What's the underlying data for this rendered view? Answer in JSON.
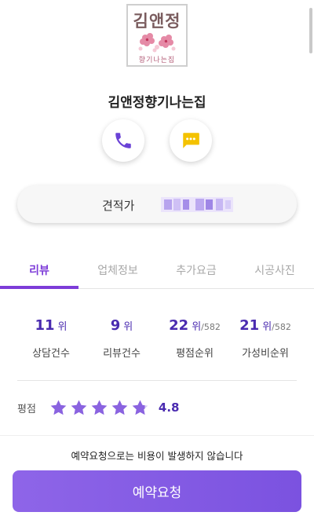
{
  "logo": {
    "title": "김앤정",
    "subtitle": "향기나는집"
  },
  "shop": {
    "name": "김앤정향기나는집"
  },
  "actions": {
    "phone_icon": "phone-icon",
    "chat_icon": "chat-bubble-icon",
    "accent": "#6a42d6",
    "chat_color": "#f4c200"
  },
  "estimate": {
    "label": "견적가"
  },
  "tabs": [
    {
      "label": "리뷰",
      "active": true
    },
    {
      "label": "업체정보",
      "active": false
    },
    {
      "label": "추가요금",
      "active": false
    },
    {
      "label": "시공사진",
      "active": false
    }
  ],
  "stats": [
    {
      "value": "11",
      "unit": "위",
      "total": "",
      "caption": "상담건수"
    },
    {
      "value": "9",
      "unit": "위",
      "total": "",
      "caption": "리뷰건수"
    },
    {
      "value": "22",
      "unit": "위",
      "total": "/582",
      "caption": "평점순위"
    },
    {
      "value": "21",
      "unit": "위",
      "total": "/582",
      "caption": "가성비순위"
    }
  ],
  "rating": {
    "label": "평점",
    "score": "4.8",
    "stars_value": 4.8,
    "stars_max": 5,
    "star_color": "#8a63e0"
  },
  "footer": {
    "notice": "예약요청으로는 비용이 발생하지 않습니다",
    "button_label": "예약요청"
  }
}
